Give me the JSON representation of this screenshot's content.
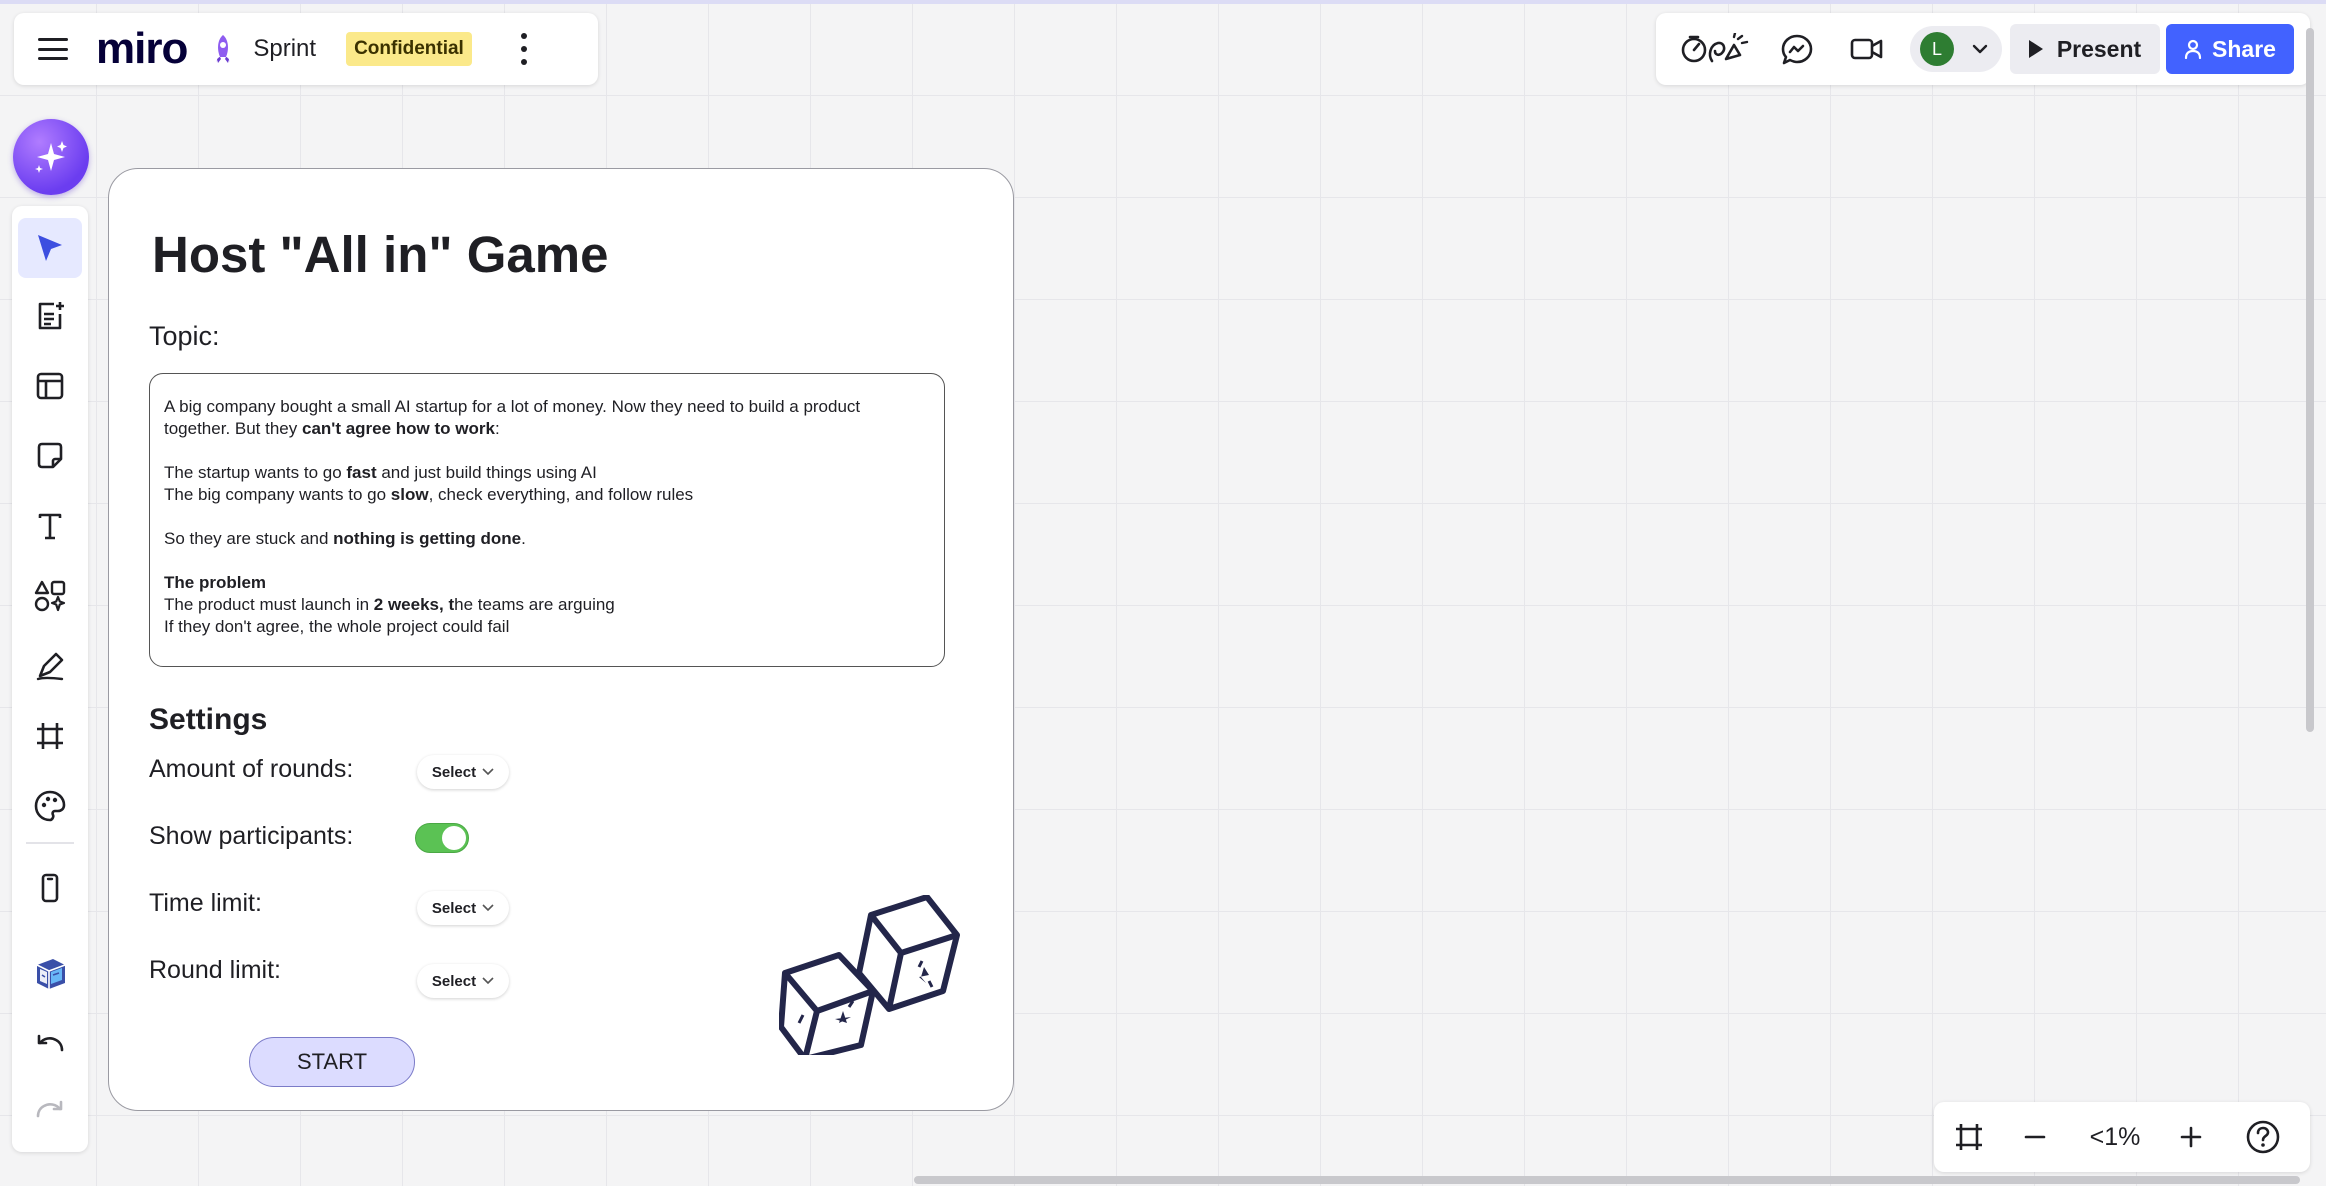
{
  "app": {
    "name": "miro"
  },
  "board": {
    "name": "Sprint",
    "badge": "Confidential"
  },
  "header_actions": {
    "present_label": "Present",
    "share_label": "Share",
    "avatar_initial": "L"
  },
  "toolbar": {
    "tools": [
      "select",
      "templates",
      "layout",
      "sticky-note",
      "text",
      "shapes",
      "pen",
      "frame",
      "stickers",
      "device",
      "3d",
      "undo",
      "redo"
    ],
    "active_tool": "select"
  },
  "frame": {
    "title": "Host \"All in\" Game",
    "topic_label": "Topic:",
    "topic": {
      "p1_a": "A big company bought a small AI startup for a lot of money. Now they need to build a product",
      "p1_b": "together. But they ",
      "p1_bold": "can't agree how to work",
      "p1_end": ":",
      "p2_a": "The startup wants to go ",
      "p2_bold": "fast",
      "p2_end": " and just build things using AI",
      "p3_a": "The big company wants to go ",
      "p3_bold": "slow",
      "p3_end": ", check everything, and follow rules",
      "p4_a": "So they are stuck and ",
      "p4_bold": "nothing is getting done",
      "p4_end": ".",
      "problem_heading": "The problem",
      "p5_a": "The product must launch in ",
      "p5_bold": "2 weeks, t",
      "p5_end": "he teams are arguing",
      "p6": "If they don't agree, the whole project could fail"
    },
    "settings_title": "Settings",
    "settings": {
      "rounds_label": "Amount of rounds:",
      "rounds_value": "Select",
      "participants_label": "Show participants:",
      "participants_on": true,
      "time_label": "Time limit:",
      "time_value": "Select",
      "round_limit_label": "Round limit:",
      "round_limit_value": "Select"
    },
    "start_label": "START"
  },
  "zoom": {
    "level": "<1%"
  },
  "colors": {
    "accent": "#4262ff",
    "ai_purple": "#7b4ff0",
    "badge_yellow": "#fbe98a",
    "toggle_green": "#5bc254",
    "start_fill": "#dcdcff"
  }
}
